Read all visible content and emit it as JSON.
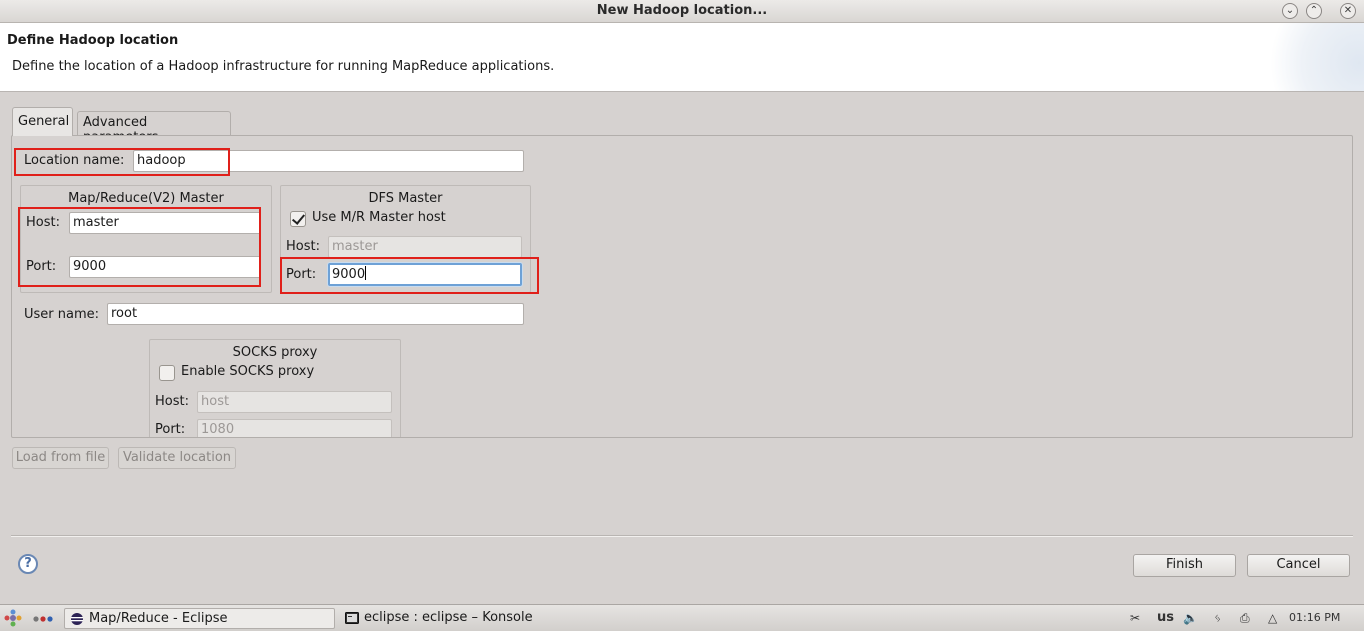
{
  "window": {
    "title": "New Hadoop location...",
    "controls": [
      "minimize-icon",
      "maximize-icon",
      "close-icon"
    ]
  },
  "header": {
    "title": "Define Hadoop location",
    "description": "Define the location of a Hadoop infrastructure for running MapReduce applications."
  },
  "tabs": [
    {
      "label": "General",
      "selected": true
    },
    {
      "label": "Advanced parameters",
      "selected": false
    }
  ],
  "general": {
    "location_name": {
      "label": "Location name:",
      "value": "hadoop"
    },
    "mapred_master": {
      "title": "Map/Reduce(V2) Master",
      "host": {
        "label": "Host:",
        "value": "master"
      },
      "port": {
        "label": "Port:",
        "value": "9000"
      }
    },
    "dfs_master": {
      "title": "DFS Master",
      "use_mr_host": {
        "label": "Use M/R Master host",
        "checked": true
      },
      "host": {
        "label": "Host:",
        "value": "master"
      },
      "port": {
        "label": "Port:",
        "value": "9000"
      }
    },
    "user_name": {
      "label": "User name:",
      "value": "root"
    },
    "socks_proxy": {
      "title": "SOCKS proxy",
      "enable": {
        "label": "Enable SOCKS proxy",
        "checked": false
      },
      "host": {
        "label": "Host:",
        "value": "host"
      },
      "port": {
        "label": "Port:",
        "value": "1080"
      }
    }
  },
  "actions": {
    "load_from_file": "Load from file",
    "validate_location": "Validate location"
  },
  "footer": {
    "help_symbol": "?",
    "finish": "Finish",
    "cancel": "Cancel"
  },
  "taskbar": {
    "items": [
      {
        "label": "Map/Reduce - Eclipse",
        "icon": "eclipse-icon",
        "active": true
      },
      {
        "label": "eclipse : eclipse – Konsole",
        "icon": "terminal-icon",
        "active": false
      }
    ],
    "keyboard_layout": "us",
    "clock": "01:16 PM"
  },
  "colors": {
    "highlight": "#e0201a",
    "focus": "#6ea1d6",
    "background": "#d6d2d0"
  }
}
